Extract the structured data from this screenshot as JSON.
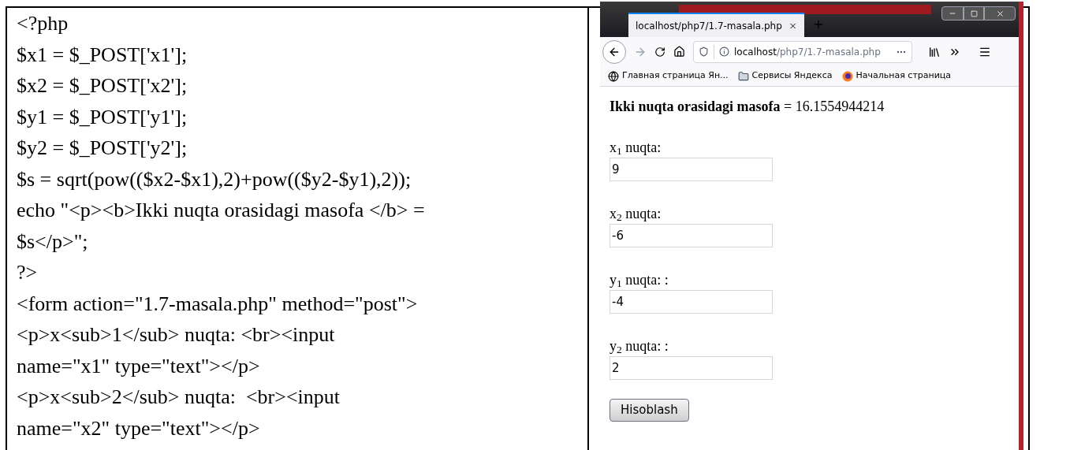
{
  "code_lines": [
    "<?php",
    "$x1 = $_POST['x1'];",
    "$x2 = $_POST['x2'];",
    "$y1 = $_POST['y1'];",
    "$y2 = $_POST['y2'];",
    "$s = sqrt(pow(($x2-$x1),2)+pow(($y2-$y1),2));",
    "echo \"<p><b>Ikki nuqta orasidagi masofa </b> =",
    "$s</p>\";",
    "?>",
    "<form action=\"1.7-masala.php\" method=\"post\">",
    "<p>x<sub>1</sub> nuqta: <br><input",
    "name=\"x1\" type=\"text\"></p>",
    "<p>x<sub>2</sub> nuqta:  <br><input",
    "name=\"x2\" type=\"text\"></p>"
  ],
  "browser": {
    "tab": {
      "title": "localhost/php7/1.7-masala.php",
      "selected": true
    },
    "address": {
      "host": "localhost",
      "path": "/php7/1.7-masala.php"
    },
    "bookmarks": [
      {
        "kind": "globe",
        "label": "Главная страница Ян..."
      },
      {
        "kind": "folder",
        "label": "Сервисы Яндекса"
      },
      {
        "kind": "firefox",
        "label": "Начальная страница"
      }
    ],
    "page": {
      "result": "**Ikki nuqta orasidagi masofa** = 16.1554944214",
      "fields": [
        {
          "label": "x$_{1}$ nuqta:",
          "value": "9"
        },
        {
          "label": "x$_{2}$ nuqta:",
          "value": "-6"
        },
        {
          "label": "y$_{1}$ nuqta: :",
          "value": "-4"
        },
        {
          "label": "y$_{2}$ nuqta: :",
          "value": "2"
        }
      ],
      "button": "Hisoblash"
    }
  }
}
